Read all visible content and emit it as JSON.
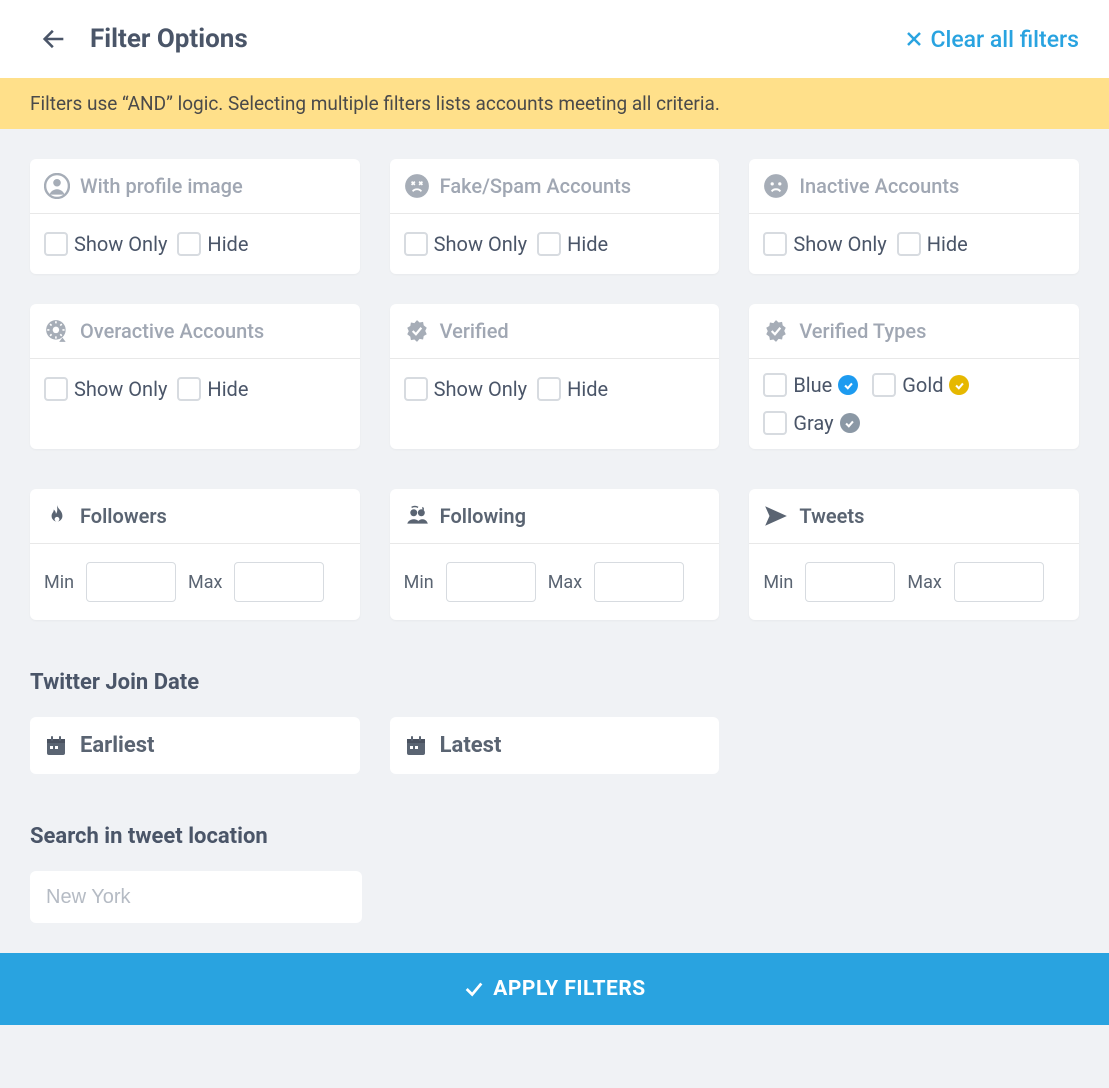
{
  "header": {
    "title": "Filter Options",
    "clear_label": "Clear all filters"
  },
  "notice": "Filters use “AND” logic. Selecting multiple filters lists accounts meeting all criteria.",
  "labels": {
    "show_only": "Show Only",
    "hide": "Hide",
    "min": "Min",
    "max": "Max"
  },
  "cards": {
    "profile_image": "With profile image",
    "fake_spam": "Fake/Spam Accounts",
    "inactive": "Inactive Accounts",
    "overactive": "Overactive Accounts",
    "verified": "Verified",
    "verified_types": "Verified Types"
  },
  "verified_type_options": {
    "blue": "Blue",
    "gold": "Gold",
    "gray": "Gray"
  },
  "metrics": {
    "followers": "Followers",
    "following": "Following",
    "tweets": "Tweets"
  },
  "sections": {
    "join_date": "Twitter Join Date",
    "tweet_location": "Search in tweet location"
  },
  "join_date": {
    "earliest": "Earliest",
    "latest": "Latest"
  },
  "location": {
    "placeholder": "New York"
  },
  "apply_label": "APPLY FILTERS"
}
